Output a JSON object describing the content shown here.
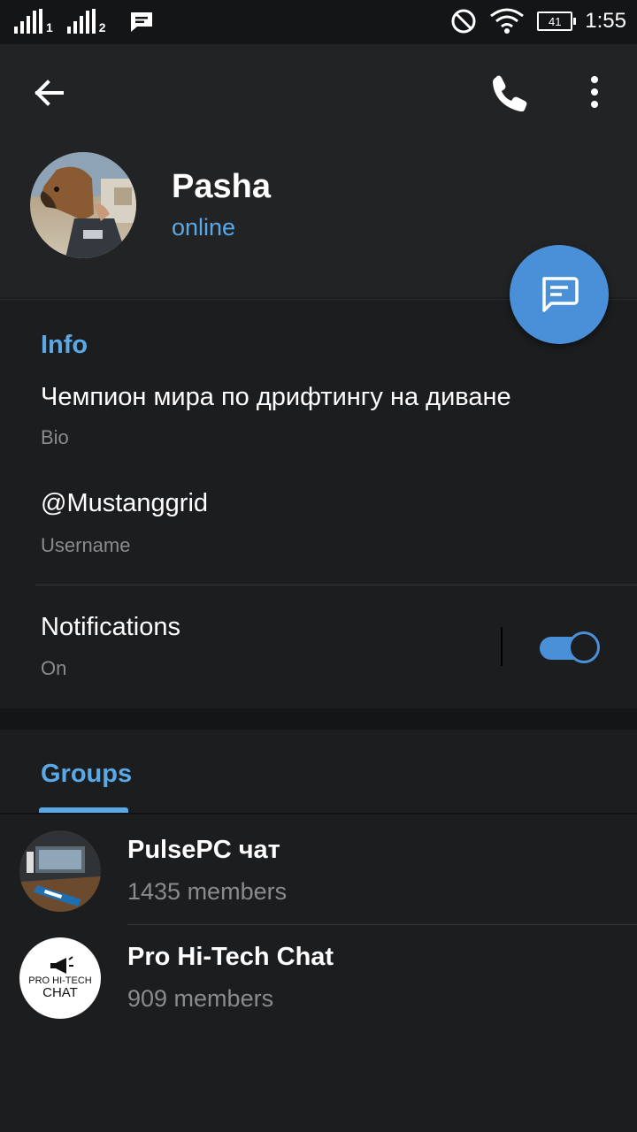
{
  "status_bar": {
    "sim1": "1",
    "sim2": "2",
    "battery": "41",
    "time": "1:55",
    "icons": [
      "signal-icon",
      "message-notification-icon",
      "do-not-disturb-icon",
      "wifi-icon",
      "battery-icon"
    ]
  },
  "profile": {
    "name": "Pasha",
    "status": "online"
  },
  "info": {
    "section_title": "Info",
    "bio": "Чемпион мира по дрифтингу на диване",
    "bio_label": "Bio",
    "username": "@Mustanggrid",
    "username_label": "Username",
    "notifications": "Notifications",
    "notifications_state": "On",
    "notifications_enabled": true
  },
  "groups": {
    "tab_title": "Groups",
    "items": [
      {
        "name": "PulsePC чат",
        "members": "1435 members"
      },
      {
        "name": "Pro Hi-Tech Chat",
        "members": "909 members",
        "logo_line1": "PRO HI-TECH",
        "logo_line2": "CHAT"
      }
    ]
  },
  "colors": {
    "accent": "#5aa9e6",
    "fab": "#4a90d9",
    "background": "#1c1d1f",
    "header": "#222325"
  }
}
